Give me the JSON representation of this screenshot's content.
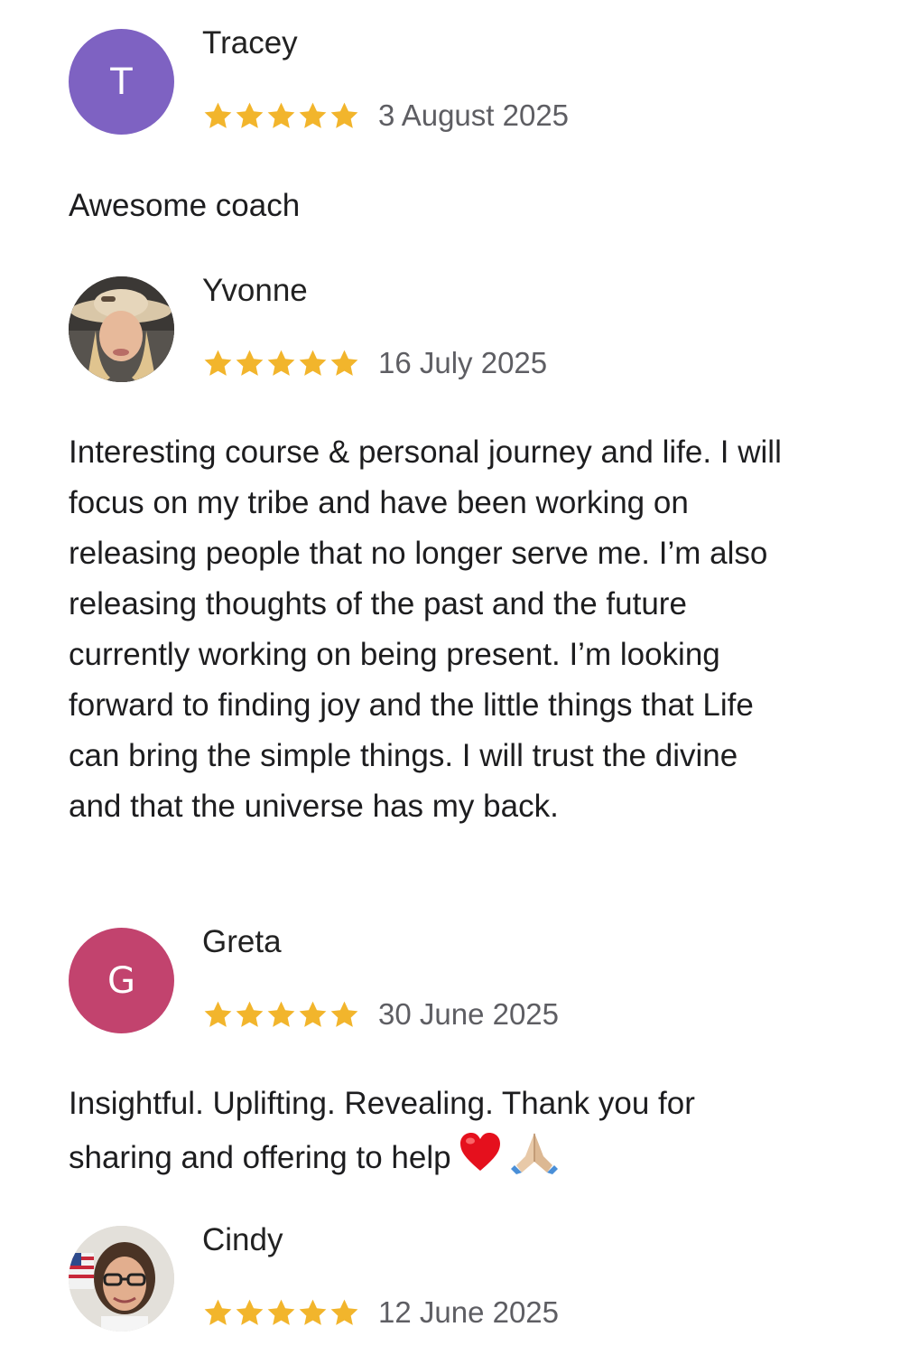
{
  "rating_star_color": "#F2B52C",
  "reviews": [
    {
      "name": "Tracey",
      "initial": "T",
      "avatar_color": "#7E62C2",
      "rating": 5,
      "date": "3 August 2025",
      "text": "Awesome coach"
    },
    {
      "name": "Yvonne",
      "avatar_type": "photo",
      "rating": 5,
      "date": "16 July 2025",
      "text": "Interesting course & personal journey and life. I will focus on my tribe and have been working on releasing people that no longer serve me. I’m also releasing thoughts of the past and the future currently working on being present. I’m looking forward to finding joy and the little things that Life can bring the simple things. I will trust the divine and that the universe has my back."
    },
    {
      "name": "Greta",
      "initial": "G",
      "avatar_color": "#C2436E",
      "rating": 5,
      "date": "30 June 2025",
      "text": "Insightful. Uplifting. Revealing. Thank you for sharing and offering to help",
      "text_emojis": [
        "red-heart-icon",
        "folded-hands-icon"
      ]
    },
    {
      "name": "Cindy",
      "avatar_type": "photo",
      "rating": 5,
      "date": "12 June 2025"
    }
  ]
}
